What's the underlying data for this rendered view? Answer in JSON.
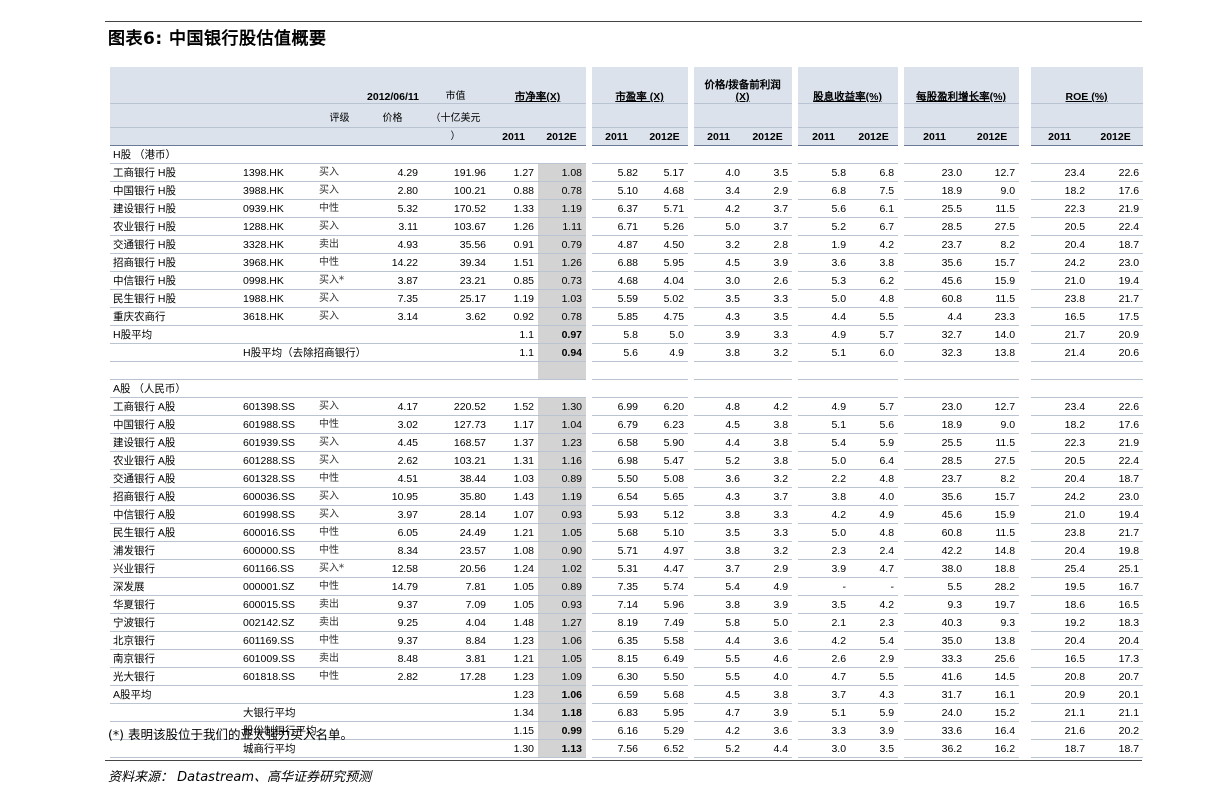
{
  "title": "图表6: 中国银行股估值概要",
  "headers": {
    "date": "2012/06/11",
    "mktcap": "市值",
    "mktcap_unit": "（十亿美元",
    "mktcap_unit2": "）",
    "pb": "市净率(X)",
    "pe": "市盈率 (X)",
    "ppop_1": "价格/拨备前利润",
    "ppop_2": "(X)",
    "dy": "股息收益率(%)",
    "epsg": "每股盈利增长率(%)",
    "roe": "ROE (%)",
    "rating": "评级",
    "price": "价格",
    "y1": "2011",
    "y2": "2012E"
  },
  "h_section": "H股 （港币）",
  "a_section": "A股 （人民币）",
  "h_rows": [
    [
      "工商银行 H股",
      "1398.HK",
      "买入",
      "4.29",
      "191.96",
      "1.27",
      "1.08",
      "5.82",
      "5.17",
      "4.0",
      "3.5",
      "5.8",
      "6.8",
      "23.0",
      "12.7",
      "23.4",
      "22.6"
    ],
    [
      "中国银行 H股",
      "3988.HK",
      "买入",
      "2.80",
      "100.21",
      "0.88",
      "0.78",
      "5.10",
      "4.68",
      "3.4",
      "2.9",
      "6.8",
      "7.5",
      "18.9",
      "9.0",
      "18.2",
      "17.6"
    ],
    [
      "建设银行 H股",
      "0939.HK",
      "中性",
      "5.32",
      "170.52",
      "1.33",
      "1.19",
      "6.37",
      "5.71",
      "4.2",
      "3.7",
      "5.6",
      "6.1",
      "25.5",
      "11.5",
      "22.3",
      "21.9"
    ],
    [
      "农业银行 H股",
      "1288.HK",
      "买入",
      "3.11",
      "103.67",
      "1.26",
      "1.11",
      "6.71",
      "5.26",
      "5.0",
      "3.7",
      "5.2",
      "6.7",
      "28.5",
      "27.5",
      "20.5",
      "22.4"
    ],
    [
      "交通银行 H股",
      "3328.HK",
      "卖出",
      "4.93",
      "35.56",
      "0.91",
      "0.79",
      "4.87",
      "4.50",
      "3.2",
      "2.8",
      "1.9",
      "4.2",
      "23.7",
      "8.2",
      "20.4",
      "18.7"
    ],
    [
      "招商银行 H股",
      "3968.HK",
      "中性",
      "14.22",
      "39.34",
      "1.51",
      "1.26",
      "6.88",
      "5.95",
      "4.5",
      "3.9",
      "3.6",
      "3.8",
      "35.6",
      "15.7",
      "24.2",
      "23.0"
    ],
    [
      "中信银行 H股",
      "0998.HK",
      "买入*",
      "3.87",
      "23.21",
      "0.85",
      "0.73",
      "4.68",
      "4.04",
      "3.0",
      "2.6",
      "5.3",
      "6.2",
      "45.6",
      "15.9",
      "21.0",
      "19.4"
    ],
    [
      "民生银行 H股",
      "1988.HK",
      "买入",
      "7.35",
      "25.17",
      "1.19",
      "1.03",
      "5.59",
      "5.02",
      "3.5",
      "3.3",
      "5.0",
      "4.8",
      "60.8",
      "11.5",
      "23.8",
      "21.7"
    ],
    [
      "重庆农商行",
      "3618.HK",
      "买入",
      "3.14",
      "3.62",
      "0.92",
      "0.78",
      "5.85",
      "4.75",
      "4.3",
      "3.5",
      "4.4",
      "5.5",
      "4.4",
      "23.3",
      "16.5",
      "17.5"
    ]
  ],
  "h_avg": [
    "H股平均",
    "1.1",
    "0.97",
    "5.8",
    "5.0",
    "3.9",
    "3.3",
    "4.9",
    "5.7",
    "32.7",
    "14.0",
    "21.7",
    "20.9"
  ],
  "h_avg_ex": [
    "H股平均（去除招商银行）",
    "1.1",
    "0.94",
    "5.6",
    "4.9",
    "3.8",
    "3.2",
    "5.1",
    "6.0",
    "32.3",
    "13.8",
    "21.4",
    "20.6"
  ],
  "a_rows": [
    [
      "工商银行 A股",
      "601398.SS",
      "买入",
      "4.17",
      "220.52",
      "1.52",
      "1.30",
      "6.99",
      "6.20",
      "4.8",
      "4.2",
      "4.9",
      "5.7",
      "23.0",
      "12.7",
      "23.4",
      "22.6"
    ],
    [
      "中国银行 A股",
      "601988.SS",
      "中性",
      "3.02",
      "127.73",
      "1.17",
      "1.04",
      "6.79",
      "6.23",
      "4.5",
      "3.8",
      "5.1",
      "5.6",
      "18.9",
      "9.0",
      "18.2",
      "17.6"
    ],
    [
      "建设银行 A股",
      "601939.SS",
      "买入",
      "4.45",
      "168.57",
      "1.37",
      "1.23",
      "6.58",
      "5.90",
      "4.4",
      "3.8",
      "5.4",
      "5.9",
      "25.5",
      "11.5",
      "22.3",
      "21.9"
    ],
    [
      "农业银行 A股",
      "601288.SS",
      "买入",
      "2.62",
      "103.21",
      "1.31",
      "1.16",
      "6.98",
      "5.47",
      "5.2",
      "3.8",
      "5.0",
      "6.4",
      "28.5",
      "27.5",
      "20.5",
      "22.4"
    ],
    [
      "交通银行 A股",
      "601328.SS",
      "中性",
      "4.51",
      "38.44",
      "1.03",
      "0.89",
      "5.50",
      "5.08",
      "3.6",
      "3.2",
      "2.2",
      "4.8",
      "23.7",
      "8.2",
      "20.4",
      "18.7"
    ],
    [
      "招商银行 A股",
      "600036.SS",
      "买入",
      "10.95",
      "35.80",
      "1.43",
      "1.19",
      "6.54",
      "5.65",
      "4.3",
      "3.7",
      "3.8",
      "4.0",
      "35.6",
      "15.7",
      "24.2",
      "23.0"
    ],
    [
      "中信银行 A股",
      "601998.SS",
      "买入",
      "3.97",
      "28.14",
      "1.07",
      "0.93",
      "5.93",
      "5.12",
      "3.8",
      "3.3",
      "4.2",
      "4.9",
      "45.6",
      "15.9",
      "21.0",
      "19.4"
    ],
    [
      "民生银行 A股",
      "600016.SS",
      "中性",
      "6.05",
      "24.49",
      "1.21",
      "1.05",
      "5.68",
      "5.10",
      "3.5",
      "3.3",
      "5.0",
      "4.8",
      "60.8",
      "11.5",
      "23.8",
      "21.7"
    ],
    [
      "浦发银行",
      "600000.SS",
      "中性",
      "8.34",
      "23.57",
      "1.08",
      "0.90",
      "5.71",
      "4.97",
      "3.8",
      "3.2",
      "2.3",
      "2.4",
      "42.2",
      "14.8",
      "20.4",
      "19.8"
    ],
    [
      "兴业银行",
      "601166.SS",
      "买入*",
      "12.58",
      "20.56",
      "1.24",
      "1.02",
      "5.31",
      "4.47",
      "3.7",
      "2.9",
      "3.9",
      "4.7",
      "38.0",
      "18.8",
      "25.4",
      "25.1"
    ],
    [
      "深发展",
      "000001.SZ",
      "中性",
      "14.79",
      "7.81",
      "1.05",
      "0.89",
      "7.35",
      "5.74",
      "5.4",
      "4.9",
      "-",
      "-",
      "5.5",
      "28.2",
      "19.5",
      "16.7"
    ],
    [
      "华夏银行",
      "600015.SS",
      "卖出",
      "9.37",
      "7.09",
      "1.05",
      "0.93",
      "7.14",
      "5.96",
      "3.8",
      "3.9",
      "3.5",
      "4.2",
      "9.3",
      "19.7",
      "18.6",
      "16.5"
    ],
    [
      "宁波银行",
      "002142.SZ",
      "卖出",
      "9.25",
      "4.04",
      "1.48",
      "1.27",
      "8.19",
      "7.49",
      "5.8",
      "5.0",
      "2.1",
      "2.3",
      "40.3",
      "9.3",
      "19.2",
      "18.3"
    ],
    [
      "北京银行",
      "601169.SS",
      "中性",
      "9.37",
      "8.84",
      "1.23",
      "1.06",
      "6.35",
      "5.58",
      "4.4",
      "3.6",
      "4.2",
      "5.4",
      "35.0",
      "13.8",
      "20.4",
      "20.4"
    ],
    [
      "南京银行",
      "601009.SS",
      "卖出",
      "8.48",
      "3.81",
      "1.21",
      "1.05",
      "8.15",
      "6.49",
      "5.5",
      "4.6",
      "2.6",
      "2.9",
      "33.3",
      "25.6",
      "16.5",
      "17.3"
    ],
    [
      "光大银行",
      "601818.SS",
      "中性",
      "2.82",
      "17.28",
      "1.23",
      "1.09",
      "6.30",
      "5.50",
      "5.5",
      "4.0",
      "4.7",
      "5.5",
      "41.6",
      "14.5",
      "20.8",
      "20.7"
    ]
  ],
  "a_avg": [
    "A股平均",
    "1.23",
    "1.06",
    "6.59",
    "5.68",
    "4.5",
    "3.8",
    "3.7",
    "4.3",
    "31.7",
    "16.1",
    "20.9",
    "20.1"
  ],
  "a_sub": [
    [
      "大银行平均",
      "1.34",
      "1.18",
      "6.83",
      "5.95",
      "4.7",
      "3.9",
      "5.1",
      "5.9",
      "24.0",
      "15.2",
      "21.1",
      "21.1"
    ],
    [
      "股份制银行平均",
      "1.15",
      "0.99",
      "6.16",
      "5.29",
      "4.2",
      "3.6",
      "3.3",
      "3.9",
      "33.6",
      "16.4",
      "21.6",
      "20.2"
    ],
    [
      "城商行平均",
      "1.30",
      "1.13",
      "7.56",
      "6.52",
      "5.2",
      "4.4",
      "3.0",
      "3.5",
      "36.2",
      "16.2",
      "18.7",
      "18.7"
    ]
  ],
  "footnote": "(*) 表明该股位于我们的亚太强力买入名单。",
  "source": "资料来源： Datastream、高华证券研究预测"
}
